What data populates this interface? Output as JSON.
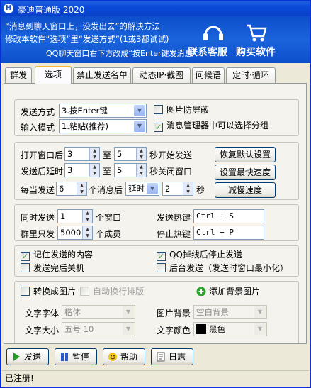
{
  "window": {
    "title": "豪迪普通版 2020",
    "icon_letter": "H"
  },
  "banner": {
    "line1": "“消息到聊天窗口上，没发出去”的解决方法",
    "line2": "修改本软件“选项”里“发送方式”(1或3都试试)",
    "line3": "QQ聊天窗口右下方改成“按Enter键发消息”",
    "service_label": "联系客服",
    "buy_label": "购买软件"
  },
  "tabs": [
    "群发",
    "选项",
    "禁止发送名单",
    "动态IP·截图",
    "问候语",
    "定时·循环"
  ],
  "active_tab": "选项",
  "send": {
    "method_label": "发送方式",
    "method_value": "3.按Enter键",
    "input_label": "输入模式",
    "input_value": "1.粘贴(推荐)",
    "anti_block_label": "图片防屏蔽",
    "anti_block_checked": false,
    "group_select_label": "消息管理器中可以选择分组",
    "group_select_checked": true
  },
  "timing": {
    "open_label": "打开窗口后",
    "open_from": "3",
    "to1": "至",
    "open_to": "5",
    "open_suffix": "秒开始发送",
    "delay_label": "发送后延时",
    "delay_from": "3",
    "to2": "至",
    "delay_to": "5",
    "delay_suffix": "秒关闭窗口",
    "every_label": "每当发送",
    "every_count": "6",
    "every_mid": "个消息后",
    "every_mode": "延时",
    "every_secs": "2",
    "every_suffix": "秒",
    "restore_btn": "恢复默认设置",
    "fastest_btn": "设置最快速度",
    "slow_btn": "减慢速度"
  },
  "limits": {
    "concurrent_label": "同时发送",
    "concurrent_value": "1",
    "concurrent_unit": "个窗口",
    "group_only_label": "群里只发",
    "group_only_value": "5000",
    "group_only_unit": "个成员",
    "send_hotkey_label": "发送热键",
    "send_hotkey": "Ctrl + S",
    "stop_hotkey_label": "停止热键",
    "stop_hotkey": "Ctrl + P"
  },
  "options": {
    "remember_label": "记住发送的内容",
    "remember_checked": true,
    "shutdown_label": "发送完后关机",
    "shutdown_checked": false,
    "qq_stop_label": "QQ掉线后停止发送",
    "qq_stop_checked": true,
    "background_label": "后台发送（发送时窗口最小化）",
    "background_checked": false
  },
  "image": {
    "convert_label": "转换成图片",
    "auto_wrap_label": "自动换行排版",
    "add_bg_label": "添加背景图片",
    "font_label": "文字字体",
    "font_value": "楷体",
    "size_label": "文字大小",
    "size_value": "五号 10",
    "bg_label": "图片背景",
    "bg_value": "空白背景",
    "color_label": "文字颜色",
    "color_value": "黑色"
  },
  "buttons": {
    "send": "发送",
    "pause": "暂停",
    "help": "帮助",
    "log": "日志"
  },
  "status": "已注册!",
  "colors": {
    "title": "#0a4ad8",
    "banner": "#1a64dc",
    "check": "#21a121"
  }
}
